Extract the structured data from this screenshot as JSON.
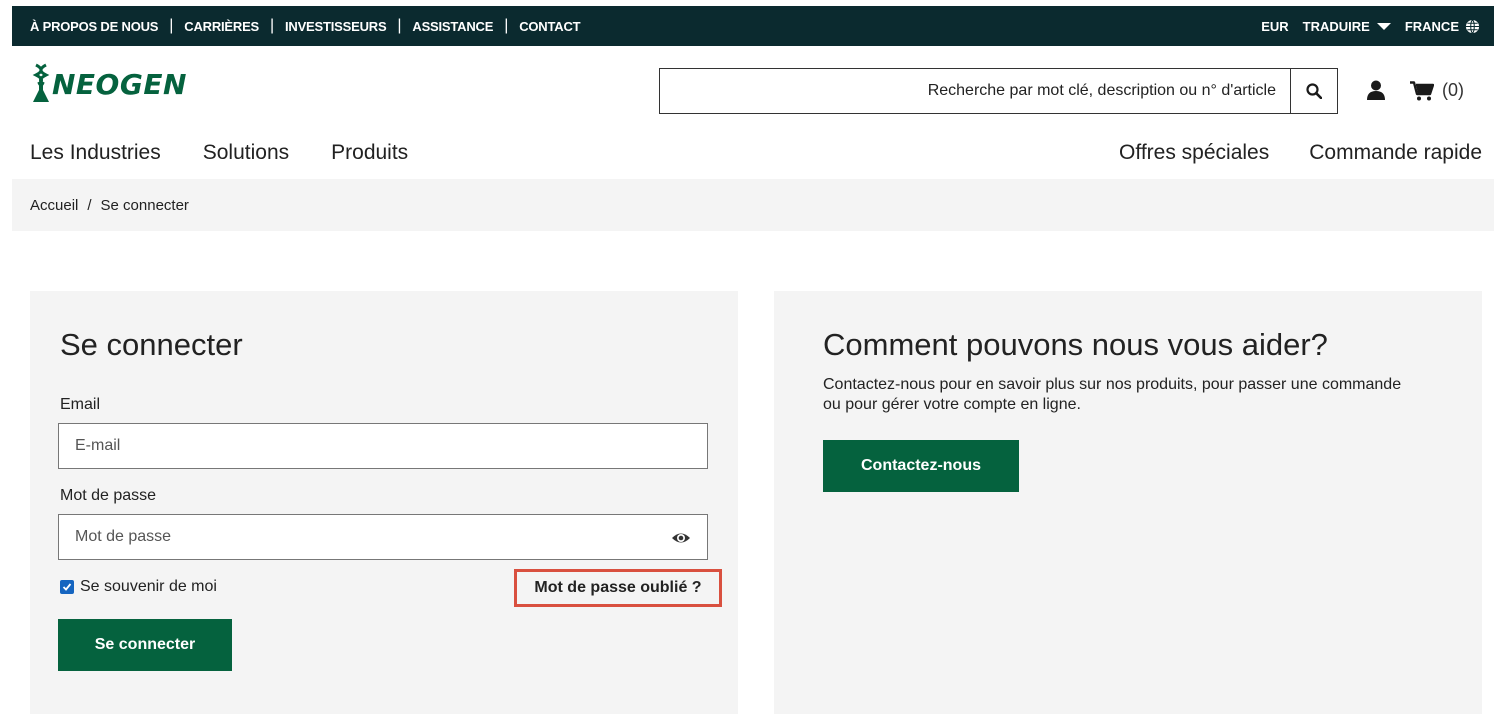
{
  "topbar": {
    "links": [
      "À PROPOS DE NOUS",
      "CARRIÈRES",
      "INVESTISSEURS",
      "ASSISTANCE",
      "CONTACT"
    ],
    "currency": "EUR",
    "translate": "TRADUIRE",
    "country": "FRANCE"
  },
  "header": {
    "logo_text": "NEOGEN",
    "search_placeholder": "Recherche par mot clé, description ou n° d'article",
    "cart_count": "(0)"
  },
  "nav": {
    "left": [
      "Les Industries",
      "Solutions",
      "Produits"
    ],
    "right": [
      "Offres spéciales",
      "Commande rapide"
    ]
  },
  "breadcrumb": {
    "home": "Accueil",
    "separator": "/",
    "current": "Se connecter"
  },
  "login": {
    "title": "Se connecter",
    "email_label": "Email",
    "email_placeholder": "E-mail",
    "password_label": "Mot de passe",
    "password_placeholder": "Mot de passe",
    "remember_label": "Se souvenir de moi",
    "forgot_label": "Mot de passe oublié ?",
    "submit_label": "Se connecter"
  },
  "help": {
    "title": "Comment pouvons nous vous aider?",
    "text": "Contactez-nous pour en savoir plus sur nos produits, pour passer une commande ou pour gérer votre compte en ligne.",
    "button_label": "Contactez-nous"
  },
  "colors": {
    "topbar_bg": "#0b2a2f",
    "brand_green": "#05623e",
    "highlight": "#d9503f"
  }
}
